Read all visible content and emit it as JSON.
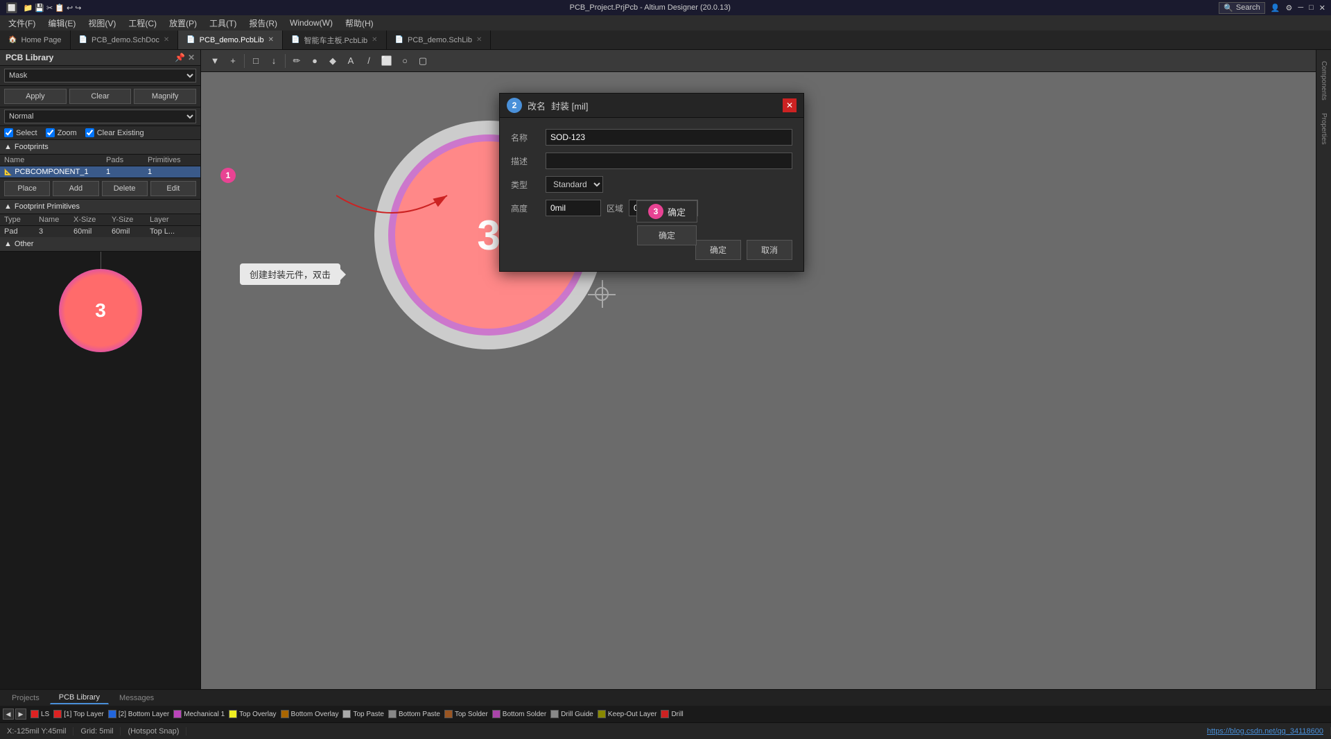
{
  "titlebar": {
    "title": "PCB_Project.PrjPcb - Altium Designer (20.0.13)",
    "search_placeholder": "Search",
    "win_min": "─",
    "win_max": "□",
    "win_close": "✕"
  },
  "menubar": {
    "items": [
      "文件(F)",
      "编辑(E)",
      "视图(V)",
      "工程(C)",
      "放置(P)",
      "工具(T)",
      "报告(R)",
      "Window(W)",
      "帮助(H)"
    ]
  },
  "tabs": [
    {
      "label": "Home Page",
      "icon": "🏠",
      "active": false
    },
    {
      "label": "PCB_demo.SchDoc",
      "icon": "📄",
      "active": false
    },
    {
      "label": "PCB_demo.PcbLib",
      "icon": "📄",
      "active": true
    },
    {
      "label": "智能车主板.PcbLib",
      "icon": "📄",
      "active": false
    },
    {
      "label": "PCB_demo.SchLib",
      "icon": "📄",
      "active": false
    }
  ],
  "left_panel": {
    "title": "PCB Library",
    "mask_label": "Mask",
    "apply_label": "Apply",
    "clear_label": "Clear",
    "magnify_label": "Magnify",
    "normal_label": "Normal",
    "select_label": "Select",
    "zoom_label": "Zoom",
    "clear_existing_label": "Clear Existing",
    "footprints_label": "Footprints",
    "table_headers": {
      "name": "Name",
      "pads": "Pads",
      "primitives": "Primitives"
    },
    "footprints": [
      {
        "name": "PCBCOMPONENT_1",
        "pads": "1",
        "primitives": "1"
      }
    ],
    "place_label": "Place",
    "add_label": "Add",
    "delete_label": "Delete",
    "edit_label": "Edit",
    "footprint_primitives_label": "Footprint Primitives",
    "prim_headers": {
      "type": "Type",
      "name": "Name",
      "x_size": "X-Size",
      "y_size": "Y-Size",
      "layer": "Layer"
    },
    "primitives": [
      {
        "type": "Pad",
        "name": "3",
        "x_size": "60mil",
        "y_size": "60mil",
        "layer": "Top L..."
      }
    ],
    "other_label": "Other"
  },
  "toolbar": {
    "buttons": [
      "▼",
      "+",
      "□",
      "↓",
      "✏",
      "●",
      "◆",
      "A",
      "/\\",
      "⬜",
      "○",
      "□"
    ]
  },
  "modal": {
    "title": "改名",
    "subtitle": "封装 [mil]",
    "step_badge": "2",
    "name_label": "名称",
    "name_value": "SOD-123",
    "desc_label": "描述",
    "desc_value": "",
    "type_label": "类型",
    "type_value": "Standard",
    "height_label": "高度",
    "height_value": "0mil",
    "area_label": "区域",
    "area_value": "0 sq.inch",
    "ok_label": "确定",
    "cancel_label": "取消",
    "close_btn": "✕",
    "confirm_badge": "3",
    "confirm_label": "确定"
  },
  "annotation": {
    "step1_badge": "1",
    "step1_text": "创建封装元件，双击",
    "step3_badge": "3"
  },
  "right_sidebar": {
    "tabs": [
      "Components",
      "Properties"
    ]
  },
  "bottom_tabs": {
    "tabs": [
      "Projects",
      "PCB Library",
      "Messages"
    ],
    "active": "PCB Library"
  },
  "layer_bar": {
    "layers": [
      {
        "label": "LS",
        "color": "#dd2222"
      },
      {
        "label": "[1] Top Layer",
        "color": "#dd2222"
      },
      {
        "label": "[2] Bottom Layer",
        "color": "#2266dd"
      },
      {
        "label": "Mechanical 1",
        "color": "#bb44bb"
      },
      {
        "label": "Top Overlay",
        "color": "#eeee22"
      },
      {
        "label": "Bottom Overlay",
        "color": "#aa6600"
      },
      {
        "label": "Top Paste",
        "color": "#aaaaaa"
      },
      {
        "label": "Bottom Paste",
        "color": "#888888"
      },
      {
        "label": "Top Solder",
        "color": "#995522"
      },
      {
        "label": "Bottom Solder",
        "color": "#aa44aa"
      },
      {
        "label": "Drill Guide",
        "color": "#888888"
      },
      {
        "label": "Keep-Out Layer",
        "color": "#888800"
      },
      {
        "label": "Drill",
        "color": "#cc2222"
      }
    ]
  },
  "statusbar": {
    "coords": "X:-125mil Y:45mil",
    "grid": "Grid: 5mil",
    "snap": "(Hotspot Snap)",
    "url": "https://blog.csdn.net/qq_34118600"
  },
  "preview_pad": {
    "number": "3"
  }
}
